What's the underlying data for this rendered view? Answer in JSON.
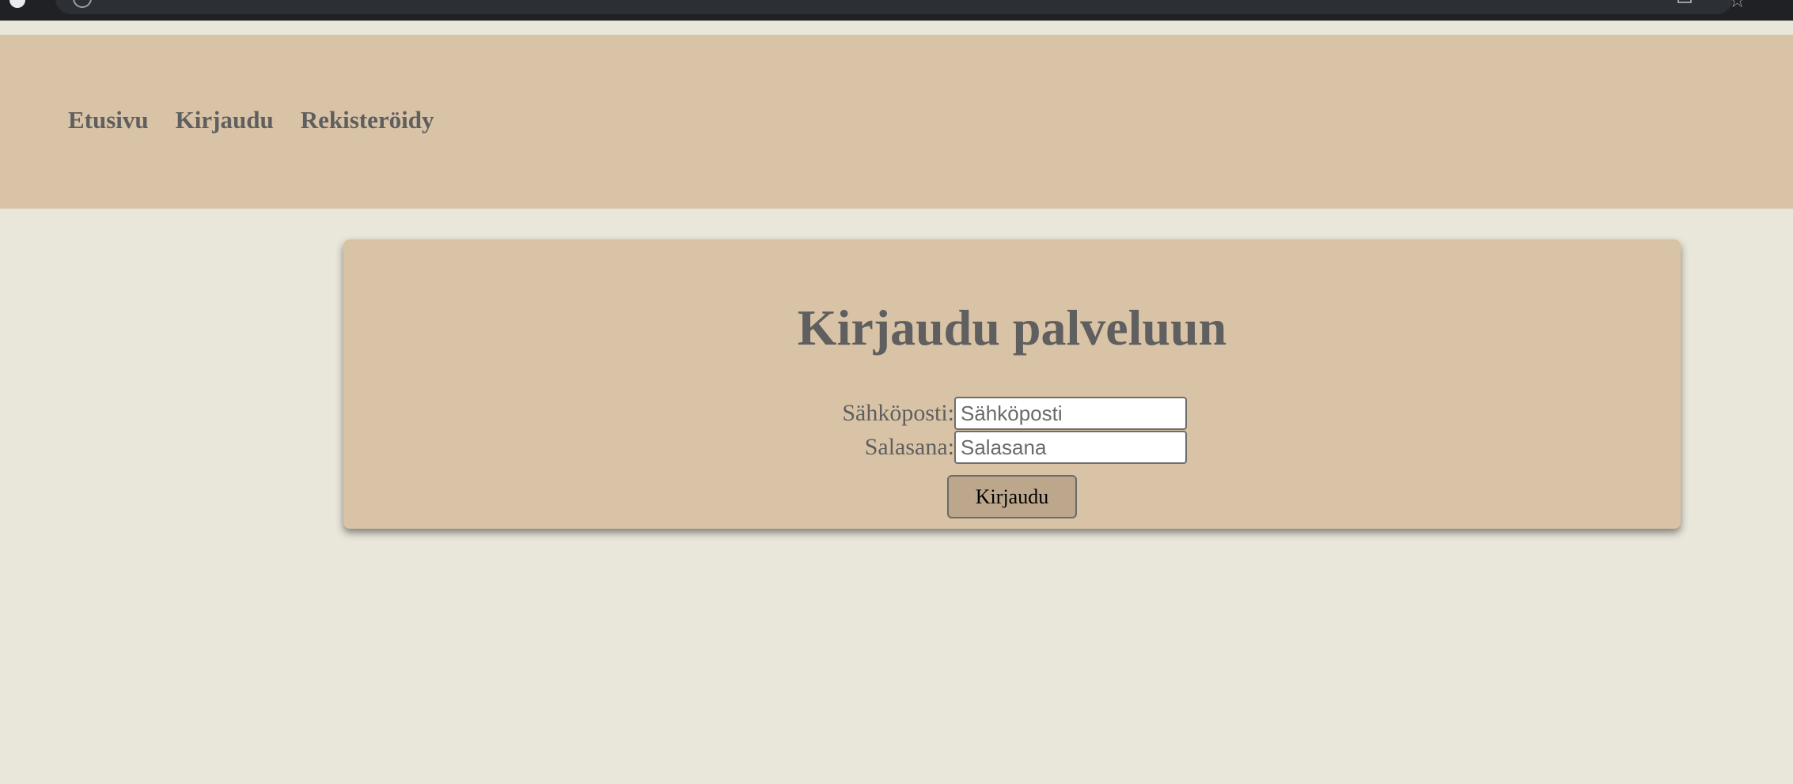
{
  "browser": {
    "address_bar": "",
    "icons": [
      "info-icon",
      "install-icon",
      "star-icon"
    ]
  },
  "nav": {
    "items": [
      {
        "label": "Etusivu"
      },
      {
        "label": "Kirjaudu"
      },
      {
        "label": "Rekisteröidy"
      }
    ]
  },
  "login": {
    "title": "Kirjaudu palveluun",
    "email": {
      "label": "Sähköposti:",
      "placeholder": "Sähköposti",
      "value": ""
    },
    "password": {
      "label": "Salasana:",
      "placeholder": "Salasana",
      "value": ""
    },
    "submit_label": "Kirjaudu"
  },
  "colors": {
    "page_background": "#e9e6da",
    "header_background": "#d9c3a6",
    "card_background": "#d9c3a6",
    "button_background": "#bca78c",
    "text": "#5f5f5f",
    "browser_chrome": "#1f2124"
  }
}
